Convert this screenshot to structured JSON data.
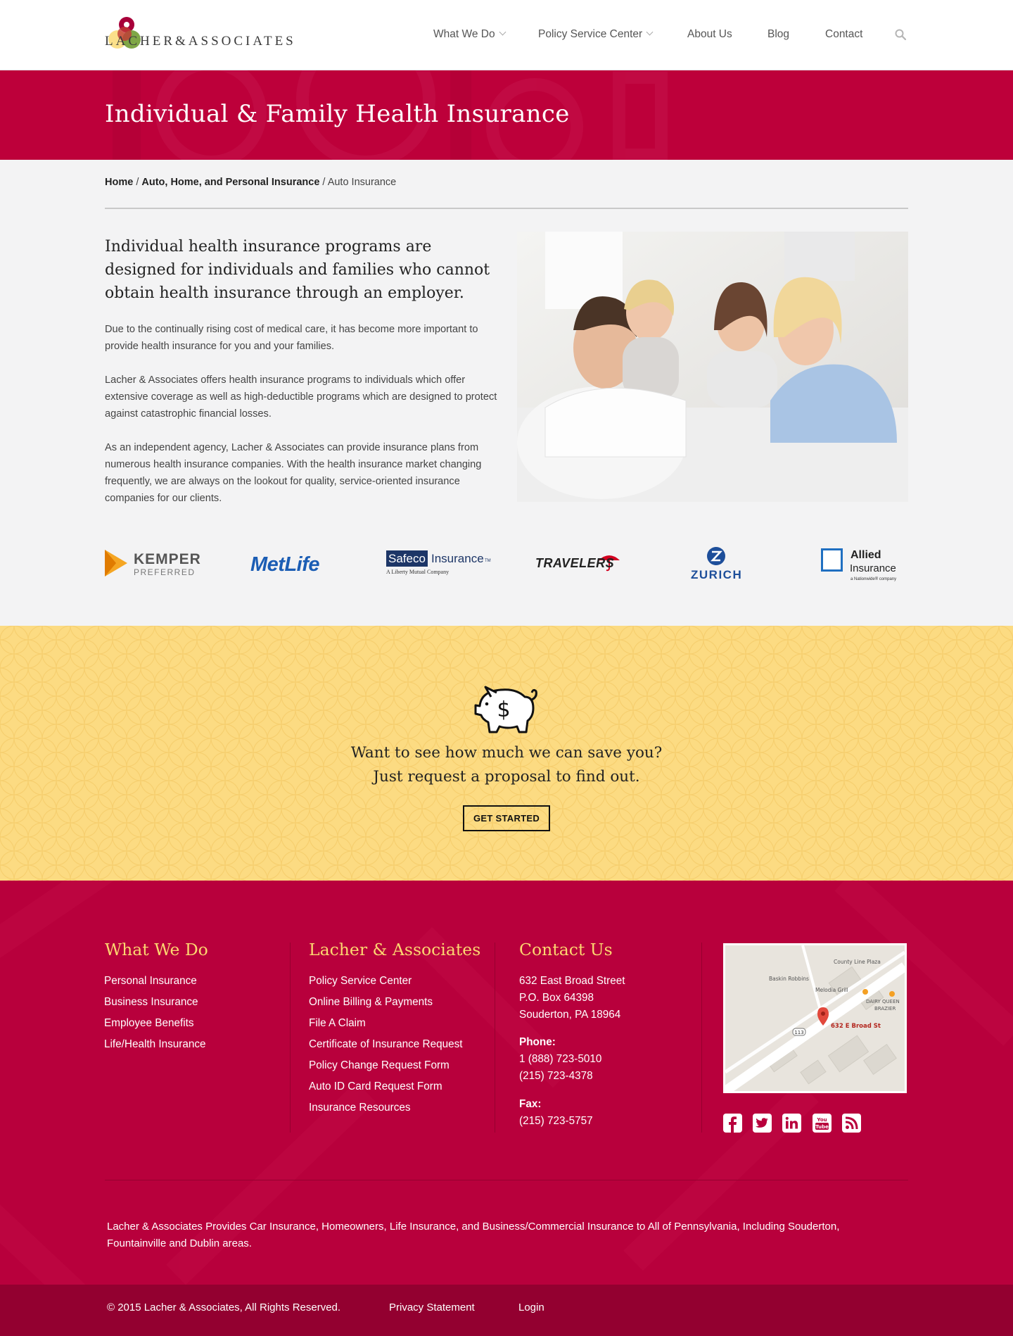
{
  "header": {
    "logo": {
      "wordmark": "LACHER&ASSOCIATES"
    },
    "nav": [
      {
        "label": "What We Do",
        "dropdown": true
      },
      {
        "label": "Policy Service Center",
        "dropdown": true
      },
      {
        "label": "About Us"
      },
      {
        "label": "Blog"
      },
      {
        "label": "Contact"
      }
    ],
    "search_icon": "search-icon"
  },
  "hero": {
    "title": "Individual & Family Health Insurance",
    "color": "#bd003a"
  },
  "breadcrumb": {
    "home": "Home",
    "section": "Auto, Home, and Personal Insurance",
    "current": "Auto Insurance",
    "separator": "/"
  },
  "intro": {
    "lead": "Individual health insurance programs are designed for individuals and families who cannot obtain health insurance through an employer.",
    "paragraphs": [
      "Due to the continually rising cost of medical care, it has become more important to provide health insurance for you and your families.",
      "Lacher & Associates offers health insurance programs to individuals which offer extensive coverage as well as high-deductible programs which are designed to protect against catastrophic financial losses.",
      "As an independent agency, Lacher & Associates can provide insurance plans from numerous health insurance companies. With the health insurance market changing frequently, we are always on the lookout for quality, service-oriented insurance companies for our clients."
    ]
  },
  "carriers": {
    "kemper": {
      "name": "KEMPER",
      "sub": "PREFERRED"
    },
    "metlife": {
      "name": "MetLife"
    },
    "safeco": {
      "name_a": "Safeco",
      "name_b": "Insurance",
      "tm": "TM",
      "sub": "A Liberty Mutual Company"
    },
    "travelers": {
      "name": "TRAVELERS"
    },
    "zurich": {
      "name": "ZURICH"
    },
    "allied": {
      "name_a": "Allied",
      "name_b": "Insurance",
      "sub": "a Nationwide® company"
    }
  },
  "cta": {
    "icon": "piggy-bank-icon",
    "line1": "Want to see how much we can save you?",
    "line2": "Just request a proposal to find out.",
    "button": "GET STARTED",
    "color": "#fcdb82"
  },
  "footer": {
    "what_we_do": {
      "title": "What We Do",
      "links": [
        "Personal Insurance",
        "Business Insurance",
        "Employee Benefits",
        "Life/Health Insurance"
      ]
    },
    "lacher": {
      "title": "Lacher & Associates",
      "links": [
        "Policy Service Center",
        "Online Billing & Payments",
        "File A Claim",
        "Certificate of Insurance Request",
        "Policy Change Request Form",
        "Auto ID Card Request Form",
        "Insurance Resources"
      ]
    },
    "contact": {
      "title": "Contact Us",
      "address": [
        "632 East Broad Street",
        "P.O. Box 64398",
        "Souderton, PA 18964"
      ],
      "phone_label": "Phone:",
      "phones": [
        "1 (888) 723-5010",
        "(215) 723-4378"
      ],
      "fax_label": "Fax:",
      "fax": "(215) 723-5757"
    },
    "map": {
      "labels": [
        "County Line Plaza",
        "Baskin Robbins",
        "Melodia Grill",
        "DAIRY QUEEN",
        "BRAZIER",
        "632 E Broad St",
        "113"
      ]
    },
    "social": [
      "facebook-icon",
      "twitter-icon",
      "linkedin-icon",
      "youtube-icon",
      "rss-icon"
    ],
    "youtube_text": {
      "a": "You",
      "b": "Tube"
    },
    "description": "Lacher & Associates Provides Car Insurance, Homeowners, Life Insurance, and Business/Commercial Insurance to All of Pennsylvania, Including Souderton, Fountainville and Dublin areas.",
    "copyright": "© 2015 Lacher & Associates, All Rights Reserved.",
    "privacy": "Privacy Statement",
    "login": "Login",
    "color": "#b8003c"
  }
}
